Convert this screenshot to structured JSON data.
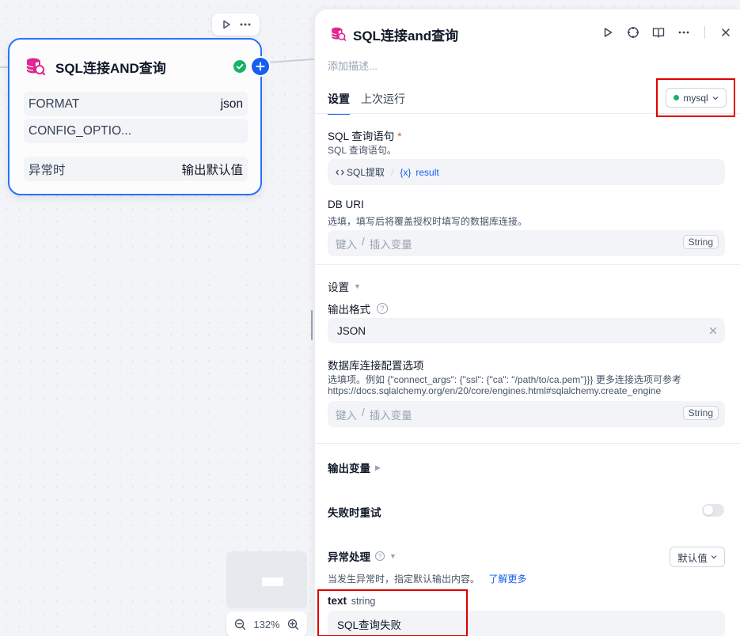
{
  "canvas": {
    "node": {
      "title": "SQL连接AND查询",
      "rows": [
        {
          "label": "FORMAT",
          "value": "json"
        },
        {
          "label": "CONFIG_OPTIO...",
          "value": ""
        },
        {
          "label": "异常时",
          "value": "输出默认值"
        }
      ]
    },
    "zoom": {
      "level": "132%"
    }
  },
  "panel": {
    "title": "SQL连接and查询",
    "description_placeholder": "添加描述...",
    "tabs": [
      {
        "label": "设置",
        "active": true
      },
      {
        "label": "上次运行",
        "active": false
      }
    ],
    "db_selector": {
      "value": "mysql",
      "status_color": "#17b26a"
    },
    "sql_query": {
      "label": "SQL 查询语句",
      "required_mark": "*",
      "hint": "SQL 查询语句。",
      "var_node": "SQL提取",
      "var_sep": "/",
      "var_prefix": "{x}",
      "var_name": "result"
    },
    "db_uri": {
      "label": "DB URI",
      "hint": "选填，填写后将覆盖授权时填写的数据库连接。",
      "placeholder_a": "键入",
      "placeholder_sep": "/",
      "placeholder_b": "插入变量",
      "type": "String"
    },
    "settings": {
      "title": "设置",
      "output_format": {
        "label": "输出格式",
        "help": "?",
        "value": "JSON"
      },
      "connect_options": {
        "label": "数据库连接配置选项",
        "hint_line1": "选填项。例如 {\"connect_args\": {\"ssl\": {\"ca\": \"/path/to/ca.pem\"}}} 更多连接选项可参考",
        "hint_line2": "https://docs.sqlalchemy.org/en/20/core/engines.html#sqlalchemy.create_engine",
        "placeholder_a": "键入",
        "placeholder_sep": "/",
        "placeholder_b": "插入变量",
        "type": "String"
      }
    },
    "output_vars": {
      "title": "输出变量"
    },
    "retry": {
      "title": "失败时重试",
      "enabled": false
    },
    "error_handling": {
      "title": "异常处理",
      "help": "?",
      "mode": "默认值",
      "hint": "当发生异常时，指定默认输出内容。",
      "learn_more": "了解更多",
      "var_name": "text",
      "var_type": "string",
      "default_value": "SQL查询失败"
    }
  },
  "colors": {
    "accent": "#155eef",
    "highlight": "#e00000",
    "success": "#17b26a"
  }
}
